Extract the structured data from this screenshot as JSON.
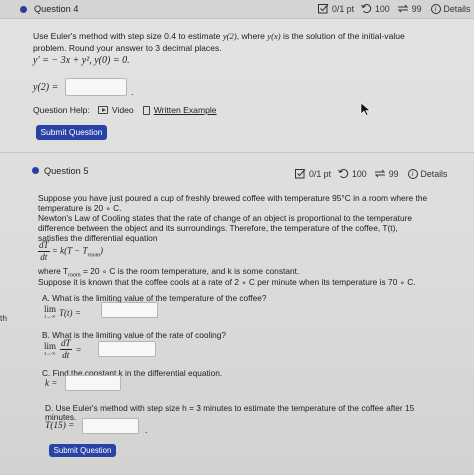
{
  "q4": {
    "title": "Question 4",
    "score": "0/1 pt",
    "retries": "100",
    "attempts": "99",
    "details": "Details",
    "intro": "Use Euler's method with step size 0.4 to estimate",
    "intro_fn": "y(2)",
    "intro_mid": ", where",
    "intro_yx": "y(x)",
    "intro_end": "is the solution of the initial-value",
    "intro2": "problem. Round your answer to 3 decimal places.",
    "ode": "y′ = − 3x + y²,   y(0) = 0.",
    "answer_label": "y(2) =",
    "answer_value": "",
    "help_label": "Question Help:",
    "video_label": "Video",
    "written_label": "Written Example",
    "submit": "Submit Question"
  },
  "q5": {
    "title": "Question 5",
    "score": "0/1 pt",
    "retries": "100",
    "attempts": "99",
    "details": "Details",
    "p1": "Suppose you have just poured a cup of freshly brewed coffee with temperature 95°C in a room where the",
    "p2": "temperature is 20 ∘ C.",
    "p3": "Newton's Law of Cooling states that the rate of change of an object is proportional to the temperature",
    "p4": "difference between the object and its surroundings. Therefore, the temperature of the coffee, T(t),",
    "p5": "satisfies the differential equation",
    "de_num": "dT",
    "de_den": "dt",
    "de_rhs": "= k(T − T",
    "de_sub": "room",
    "de_close": ")",
    "where1": "where T",
    "where_sub": "room",
    "where2": " = 20 ∘ C is the room temperature, and k is some constant.",
    "suppose": "Suppose it is known that the coffee cools at a rate of 2 ∘ C per minute when its temperature is 70 ∘ C.",
    "a_label": "A. What is the limiting value of the temperature of the coffee?",
    "a_lim": "lim",
    "a_sub": "t→∞",
    "a_expr": "T(t) =",
    "a_value": "",
    "b_label": "B. What is the limiting value of the rate of cooling?",
    "b_lim": "lim",
    "b_sub": "t→∞",
    "b_num": "dT",
    "b_den": "dt",
    "b_eq": "=",
    "b_value": "",
    "c_label": "C. Find the constant k in the differential equation.",
    "c_expr": "k =",
    "c_value": "",
    "d_label1": "D. Use Euler's method with step size h = 3 minutes to estimate the temperature of the coffee after 15",
    "d_label2": "minutes.",
    "d_expr": "T(15) =",
    "d_value": "",
    "submit": "Submit Question"
  },
  "side_fragment": "th",
  "colors": {
    "accent": "#2842a6",
    "background": "#dededc"
  }
}
